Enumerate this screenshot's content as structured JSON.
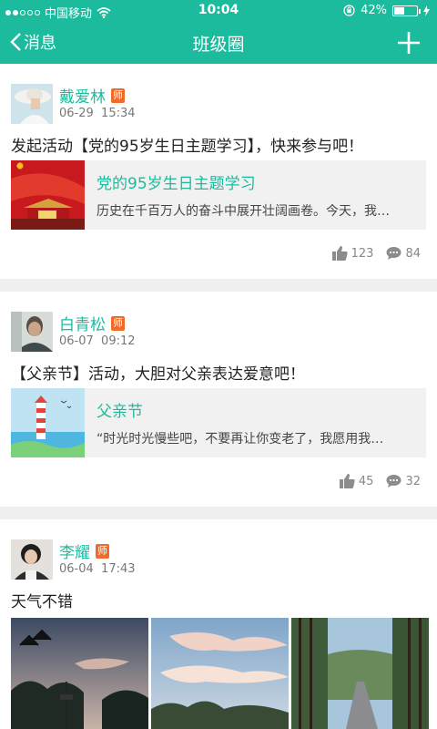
{
  "status_bar": {
    "carrier": "中国移动",
    "time": "10:04",
    "battery": "42%",
    "battery_level": 0.42,
    "signal_bars_filled": 2,
    "signal_bars_total": 5
  },
  "nav": {
    "back_label": "消息",
    "title": "班级圈",
    "add_icon": "plus-icon"
  },
  "colors": {
    "brand": "#1dbb9d",
    "teacher_badge": "#f06a29",
    "background": "#efefef"
  },
  "posts": [
    {
      "author": "戴爱林",
      "badge": "师",
      "date": "06-29",
      "time": "15:34",
      "text": "发起活动【党的95岁生日主题学习】，快来参与吧！",
      "share": {
        "title": "党的95岁生日主题学习",
        "description": "历史在千百万人的奋斗中展开壮阔画卷。今天，我…"
      },
      "likes": "123",
      "comments": "84"
    },
    {
      "author": "白青松",
      "badge": "师",
      "date": "06-07",
      "time": "09:12",
      "text": "【父亲节】活动，大胆对父亲表达爱意吧！",
      "share": {
        "title": "父亲节",
        "description": "“时光时光慢些吧，不要再让你变老了，我愿用我…"
      },
      "likes": "45",
      "comments": "32"
    },
    {
      "author": "李耀",
      "badge": "师",
      "date": "06-04",
      "time": "17:43",
      "text": "天气不错"
    }
  ]
}
